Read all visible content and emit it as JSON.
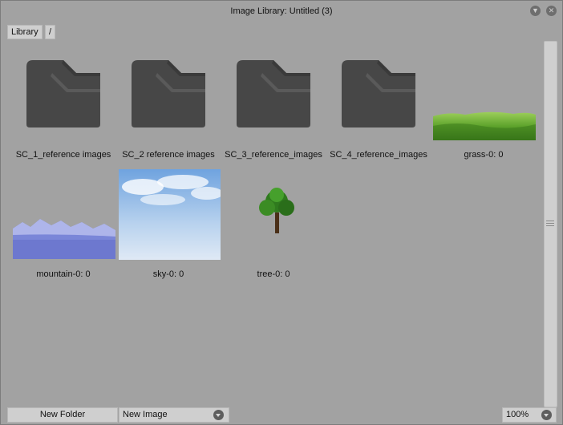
{
  "window": {
    "title": "Image Library: Untitled (3)",
    "minimize_icon": "chevron-down-icon",
    "close_icon": "close-icon"
  },
  "breadcrumb": {
    "root": "Library",
    "separator": "/"
  },
  "items": [
    {
      "label": "SC_1_reference images",
      "kind": "folder",
      "icon": "folder-icon"
    },
    {
      "label": "SC_2 reference images",
      "kind": "folder",
      "icon": "folder-icon"
    },
    {
      "label": "SC_3_reference_images",
      "kind": "folder",
      "icon": "folder-icon"
    },
    {
      "label": "SC_4_reference_images",
      "kind": "folder",
      "icon": "folder-icon"
    },
    {
      "label": "grass-0: 0",
      "kind": "image"
    },
    {
      "label": "mountain-0: 0",
      "kind": "image"
    },
    {
      "label": "sky-0: 0",
      "kind": "image"
    },
    {
      "label": "tree-0: 0",
      "kind": "image"
    }
  ],
  "footer": {
    "new_folder": "New Folder",
    "new_image": "New Image",
    "zoom": "100%"
  },
  "colors": {
    "window_bg": "#a2a2a2",
    "folder": "#474747",
    "button_bg": "#cfcfcf"
  }
}
